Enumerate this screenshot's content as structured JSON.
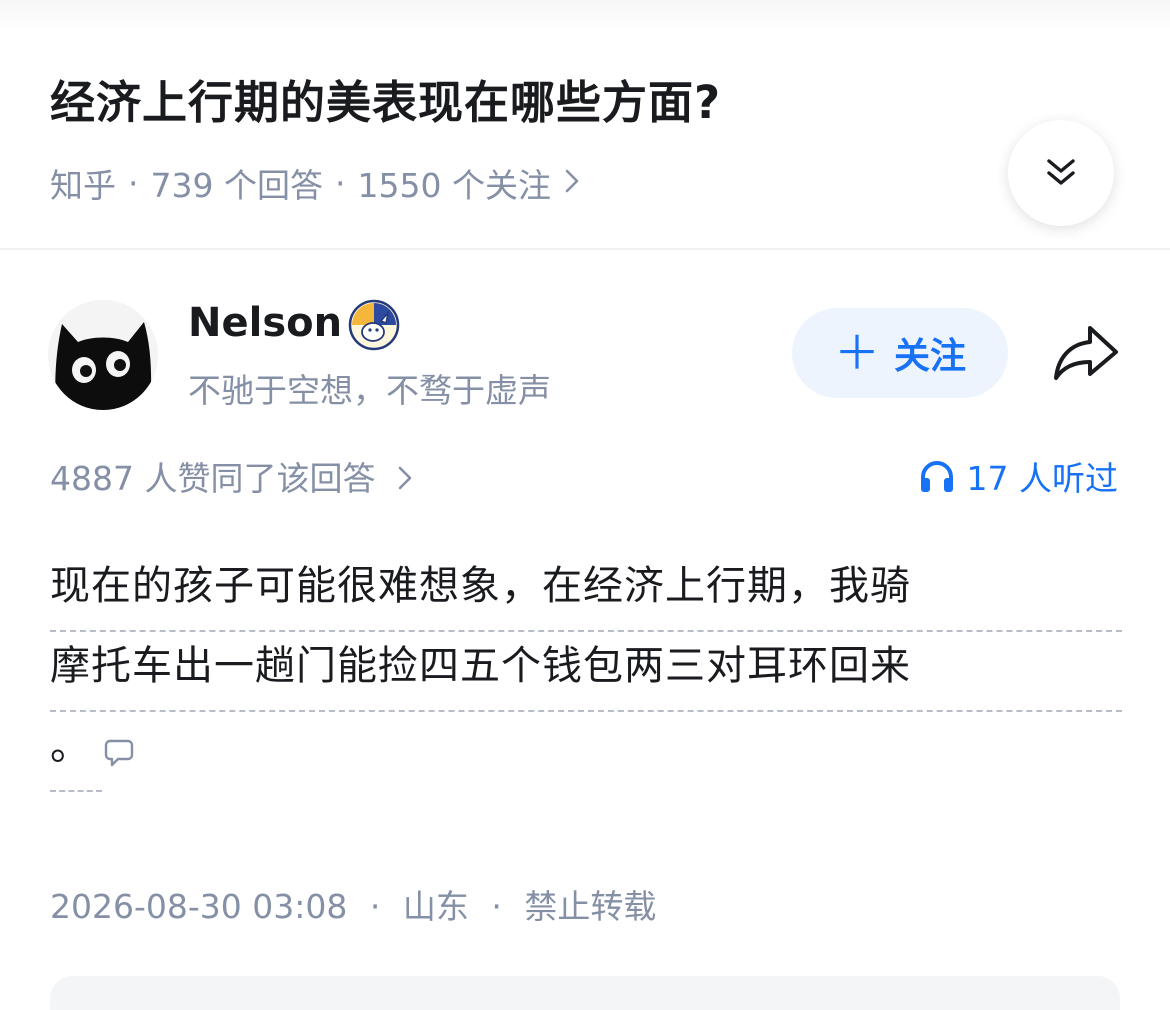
{
  "question": {
    "title": "经济上行期的美表现在哪些方面?",
    "source": "知乎",
    "answers_count": "739 个回答",
    "followers_count": "1550 个关注",
    "separator": "·"
  },
  "author": {
    "name": "Nelson",
    "bio": "不驰于空想，不骛于虚声",
    "follow_label": "关注"
  },
  "answer": {
    "upvote_text": "4887 人赞同了该回答",
    "listen_text": "17 人听过",
    "content_lines": [
      "现在的孩子可能很难想象，在经济上行期，我骑",
      "摩托车出一趟门能捡四五个钱包两三对耳环回来",
      "。"
    ],
    "date": "2026-08-30 03:08",
    "location": "山东",
    "rights": "禁止转载"
  },
  "icons": {
    "expand": "double-chevron-down-icon",
    "share": "share-arrow-icon",
    "listen": "headphones-icon",
    "comment": "comment-bubble-icon",
    "badge": "author-badge-icon"
  },
  "colors": {
    "accent": "#1772f6",
    "follow_bg": "#eef4fd",
    "meta_gray": "#8590a6",
    "text": "#191b1f"
  }
}
